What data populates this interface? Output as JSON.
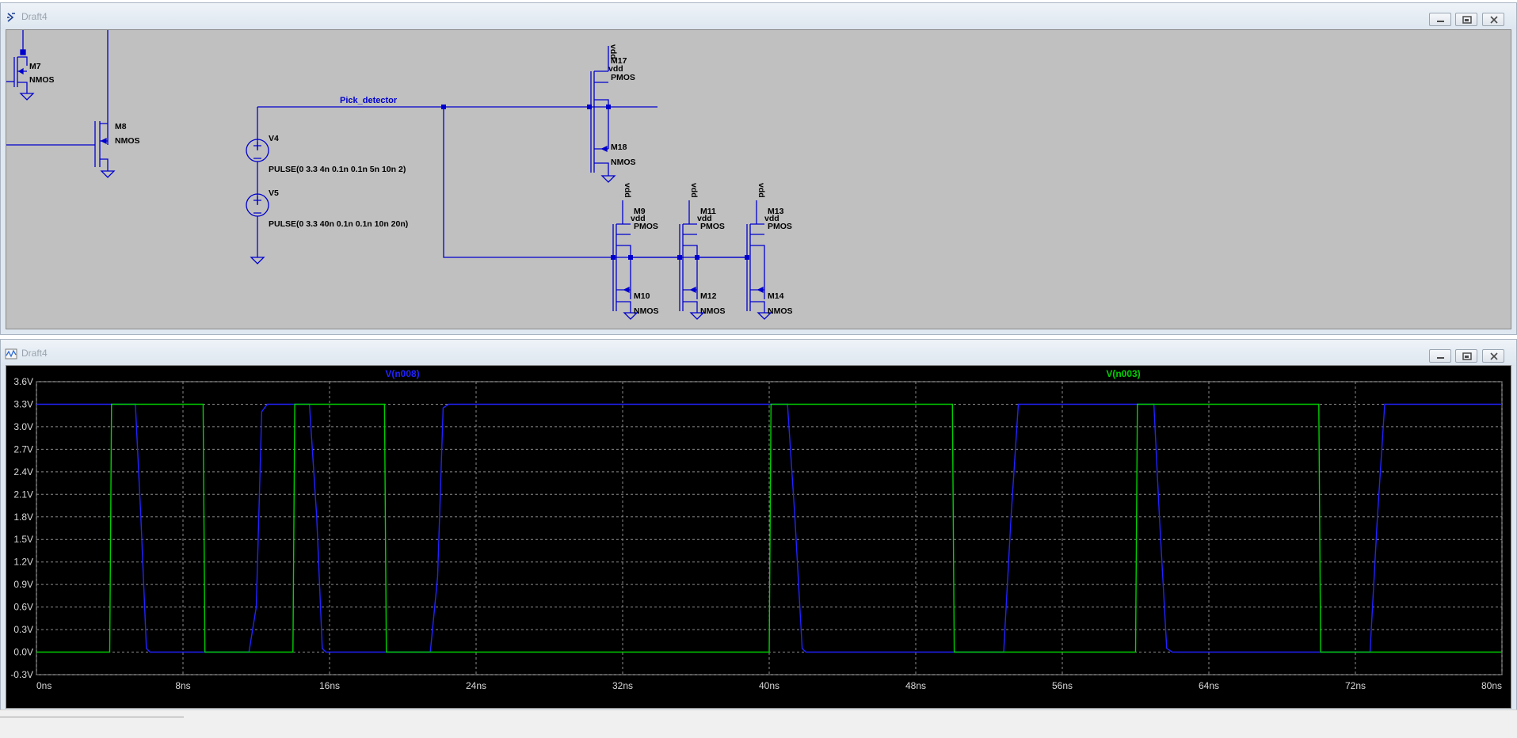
{
  "schematic_window": {
    "title": "Draft4",
    "net_label": "Pick_detector",
    "sources": [
      {
        "name": "V4",
        "value": "PULSE(0 3.3 4n 0.1n 0.1n 5n 10n 2)"
      },
      {
        "name": "V5",
        "value": "PULSE(0 3.3 40n 0.1n 0.1n 10n 20n)"
      }
    ],
    "transistors": [
      {
        "name": "M7",
        "model": "NMOS"
      },
      {
        "name": "M8",
        "model": "NMOS"
      },
      {
        "name": "M17",
        "model": "PMOS",
        "bulk": "vdd",
        "supply": "vdd"
      },
      {
        "name": "M18",
        "model": "NMOS"
      },
      {
        "name": "M9",
        "model": "PMOS",
        "bulk": "vdd",
        "supply": "vdd"
      },
      {
        "name": "M10",
        "model": "NMOS"
      },
      {
        "name": "M11",
        "model": "PMOS",
        "bulk": "vdd",
        "supply": "vdd"
      },
      {
        "name": "M12",
        "model": "NMOS"
      },
      {
        "name": "M13",
        "model": "PMOS",
        "bulk": "vdd",
        "supply": "vdd"
      },
      {
        "name": "M14",
        "model": "NMOS"
      }
    ]
  },
  "waveform_window": {
    "title": "Draft4"
  },
  "colors": {
    "wire": "#0000cc",
    "schematic_bg": "#c0c0c0",
    "plot_bg": "#000000",
    "grid": "#8c8c8c",
    "trace_blue": "#2222ff",
    "trace_green": "#00d000",
    "axis_text": "#d8d8d8"
  },
  "icons": [
    "ltspice-schematic-icon",
    "ltspice-waveform-icon",
    "minimize-icon",
    "restore-icon",
    "close-icon"
  ],
  "chart_data": {
    "type": "line",
    "xlabel": "",
    "ylabel": "",
    "x_ticks": [
      "0ns",
      "8ns",
      "16ns",
      "24ns",
      "32ns",
      "40ns",
      "48ns",
      "56ns",
      "64ns",
      "72ns",
      "80ns"
    ],
    "y_ticks": [
      "-0.3V",
      "0.0V",
      "0.3V",
      "0.6V",
      "0.9V",
      "1.2V",
      "1.5V",
      "1.8V",
      "2.1V",
      "2.4V",
      "2.7V",
      "3.0V",
      "3.3V",
      "3.6V"
    ],
    "xlim": [
      0,
      80
    ],
    "ylim": [
      -0.3,
      3.6
    ],
    "grid": true,
    "series": [
      {
        "name": "V(n008)",
        "color": "#2222ff",
        "points": [
          [
            0,
            3.3
          ],
          [
            5.4,
            3.3
          ],
          [
            5.7,
            1.8
          ],
          [
            6.0,
            0.05
          ],
          [
            6.2,
            0
          ],
          [
            11.6,
            0
          ],
          [
            12.0,
            0.6
          ],
          [
            12.3,
            3.2
          ],
          [
            12.6,
            3.3
          ],
          [
            14.9,
            3.3
          ],
          [
            15.3,
            1.8
          ],
          [
            15.6,
            0.05
          ],
          [
            15.8,
            0
          ],
          [
            21.5,
            0
          ],
          [
            21.9,
            1.0
          ],
          [
            22.2,
            3.25
          ],
          [
            22.5,
            3.3
          ],
          [
            41.0,
            3.3
          ],
          [
            41.4,
            1.8
          ],
          [
            41.8,
            0.05
          ],
          [
            42.0,
            0
          ],
          [
            52.8,
            0
          ],
          [
            53.2,
            1.8
          ],
          [
            53.6,
            3.3
          ],
          [
            61.0,
            3.3
          ],
          [
            61.3,
            1.8
          ],
          [
            61.7,
            0.05
          ],
          [
            62.0,
            0
          ],
          [
            72.8,
            0
          ],
          [
            73.2,
            1.8
          ],
          [
            73.6,
            3.3
          ],
          [
            80,
            3.3
          ]
        ]
      },
      {
        "name": "V(n003)",
        "color": "#00d000",
        "points": [
          [
            0,
            0
          ],
          [
            4.0,
            0
          ],
          [
            4.1,
            3.3
          ],
          [
            9.1,
            3.3
          ],
          [
            9.2,
            0
          ],
          [
            14.0,
            0
          ],
          [
            14.1,
            3.3
          ],
          [
            19.0,
            3.3
          ],
          [
            19.1,
            0
          ],
          [
            40.0,
            0
          ],
          [
            40.1,
            3.3
          ],
          [
            50.0,
            3.3
          ],
          [
            50.1,
            0
          ],
          [
            60.0,
            0
          ],
          [
            60.1,
            3.3
          ],
          [
            70.0,
            3.3
          ],
          [
            70.1,
            0
          ],
          [
            80,
            0
          ]
        ]
      }
    ]
  }
}
